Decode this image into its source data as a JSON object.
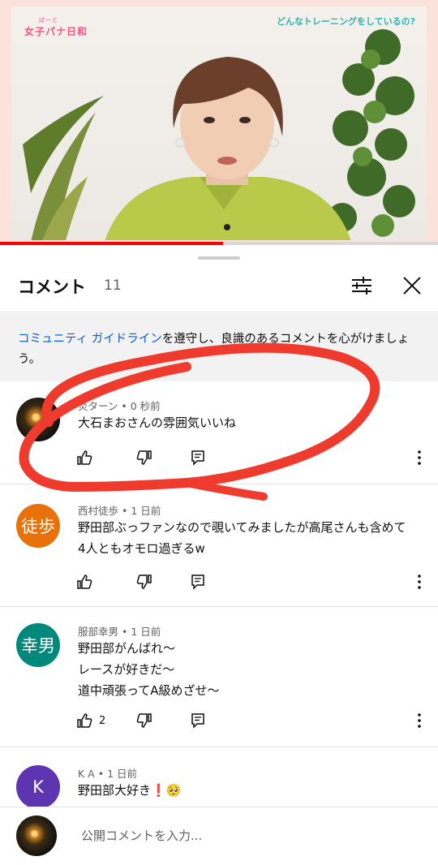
{
  "video": {
    "logo": "女子パナ日和",
    "logo_small": "ぱーと",
    "caption": "どんなトレーニングをしているの?",
    "progress": 0.51
  },
  "sheet": {
    "title": "コメント",
    "count": "11",
    "notice_link": "コミュニティ ガイドライン",
    "notice_text": "を遵守し、良識のあるコメントを心がけましょう。",
    "composer_placeholder": "公開コメントを入力..."
  },
  "comments": [
    {
      "author": "炎ターン",
      "time": "0 秒前",
      "text": "大石まおさんの雰囲気いいね",
      "likes": "",
      "avatar_text": "",
      "avatar_color": "#2a2418"
    },
    {
      "author": "西村徒歩",
      "time": "1 日前",
      "text": "野田部ぶっファンなので覗いてみましたが高尾さんも含めて\n4人ともオモロ過ぎるw",
      "likes": "",
      "avatar_text": "徒歩",
      "avatar_color": "#e8710a"
    },
    {
      "author": "服部幸男",
      "time": "1 日前",
      "text": "野田部がんばれ〜\nレースが好きだ〜\n道中頑張ってA級めざせ〜",
      "likes": "2",
      "avatar_text": "幸男",
      "avatar_color": "#00897b"
    },
    {
      "author": "K A",
      "time": "1 日前",
      "text": "野田部大好き❗🥺",
      "likes": "",
      "avatar_text": "K",
      "avatar_color": "#5e35b1"
    }
  ],
  "colors": {
    "link": "#065fd4",
    "annotation_red": "#ef3b2d"
  }
}
